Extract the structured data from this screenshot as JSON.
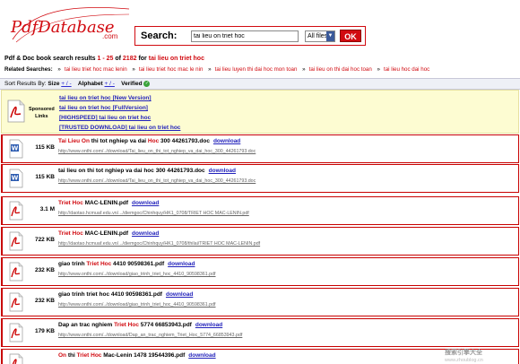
{
  "logo": {
    "text": "PdfDatabase",
    "suffix": ".com"
  },
  "search": {
    "label": "Search:",
    "query": "tai lieu on triet hoc",
    "filter_selected": "All files",
    "submit_label": "OK"
  },
  "results_info": {
    "prefix": "Pdf & Doc book search results",
    "range": "1 - 25",
    "of": "of",
    "total": "2182",
    "for": "for",
    "query": "tai lieu on triet hoc"
  },
  "related": {
    "label": "Related Searches:",
    "items": [
      "tai lieu triet hoc mac lenin",
      "tai lieu triet hoc mac le nin",
      "tai lieu luyen thi dai hoc mon toan",
      "tai lieu on thi dai hoc toan",
      "tai lieu hoc dai hoc"
    ]
  },
  "sort": {
    "label": "Sort Results By:",
    "size_label": "Size",
    "size_toggle": "+ / -",
    "alpha_label": "Alphabet",
    "alpha_toggle": "+ / -",
    "verified_label": "Verified",
    "check_glyph": "✓"
  },
  "sponsored": {
    "label_line1": "Sponsored",
    "label_line2": "Links",
    "links": [
      "tai lieu on triet hoc [New Version]",
      "tai lieu on triet hoc [FullVersion]",
      "[HIGHSPEED] tai lieu on triet hoc",
      "[TRUSTED DOWNLOAD] tai lieu on triet hoc"
    ]
  },
  "results": [
    {
      "type": "doc",
      "size": "115 KB",
      "title_parts": [
        [
          "Tai Lieu On",
          true
        ],
        [
          " thi tot nghiep va dai ",
          false
        ],
        [
          "Hoc",
          true
        ],
        [
          " 300 44261793.doc",
          false
        ]
      ],
      "download": "download",
      "url": "http://www.onthi.com/../download/Tai_lieu_on_thi_tot_nghiep_va_dai_hoc_300_44261793.doc"
    },
    {
      "type": "doc",
      "size": "115 KB",
      "title_parts": [
        [
          "tai lieu on thi tot nghiep va dai hoc 300 44261793.doc",
          false
        ]
      ],
      "download": "download",
      "url": "http://www.onthi.com/../download/Tai_lieu_on_thi_tot_nghiep_va_dai_hoc_300_44261793.doc"
    },
    {
      "type": "pdf",
      "size": "3.1 M",
      "title_parts": [
        [
          "Triet Hoc",
          true
        ],
        [
          " MAC-LENIN.pdf",
          false
        ]
      ],
      "download": "download",
      "url": "http://daotao.hcmuaf.edu.vn/.../diemgoc/Chinhquy/HK1_0708/TRIET HOC MAC-LENIN.pdf"
    },
    {
      "type": "pdf",
      "size": "722 KB",
      "title_parts": [
        [
          "Triet Hoc",
          true
        ],
        [
          " MAC-LENIN.pdf",
          false
        ]
      ],
      "download": "download",
      "url": "http://daotao.hcmuaf.edu.vn/.../diemgoc/Chinhquy/HK1_0708/thilai/TRIET HOC MAC-LENIN.pdf"
    },
    {
      "type": "pdf",
      "size": "232 KB",
      "title_parts": [
        [
          "giao trinh ",
          false
        ],
        [
          "Triet Hoc",
          true
        ],
        [
          " 4410 90598361.pdf",
          false
        ]
      ],
      "download": "download",
      "url": "http://www.onthi.com/../download/giao_trinh_triet_hoc_4410_90598361.pdf"
    },
    {
      "type": "pdf",
      "size": "232 KB",
      "title_parts": [
        [
          "giao trinh triet hoc 4410 90598361.pdf",
          false
        ]
      ],
      "download": "download",
      "url": "http://www.onthi.com/../download/giao_trinh_triet_hoc_4410_90598361.pdf"
    },
    {
      "type": "pdf",
      "size": "179 KB",
      "title_parts": [
        [
          "Dap an trac nghiem ",
          false
        ],
        [
          "Triet Hoc",
          true
        ],
        [
          " 5774 66853943.pdf",
          false
        ]
      ],
      "download": "download",
      "url": "http://www.onthi.com/../download/Dap_an_trac_nghiem_Triet_Hoc_5774_66853943.pdf"
    },
    {
      "type": "pdf",
      "size": "",
      "title_parts": [
        [
          "On",
          true
        ],
        [
          " thi ",
          false
        ],
        [
          "Triet Hoc",
          true
        ],
        [
          " Mac-Lenin 1478 19544396.pdf",
          false
        ]
      ],
      "download": "download",
      "url": ""
    }
  ],
  "watermark": {
    "line1": "搜索引擎大全",
    "line2": "www.zhoublog.cn"
  },
  "colors": {
    "accent": "#d10a10",
    "link": "#2222bb",
    "sponsored_bg": "#fdfcd2"
  }
}
